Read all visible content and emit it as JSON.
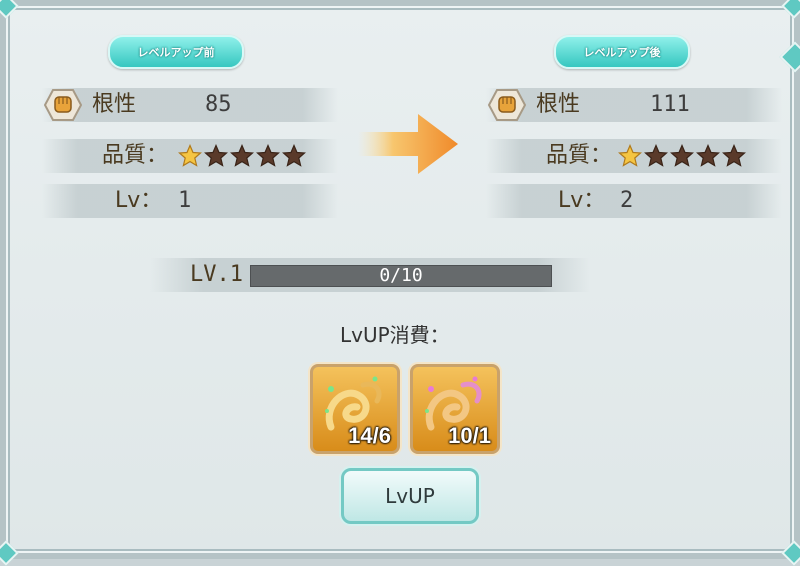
{
  "before": {
    "header": "レベルアップ前",
    "stat_label": "根性",
    "stat_value": "85",
    "quality_label": "品質：",
    "quality_stars_filled": 1,
    "quality_stars_total": 5,
    "lv_label": "Lv：",
    "lv_value": "1"
  },
  "after": {
    "header": "レベルアップ後",
    "stat_label": "根性",
    "stat_value": "111",
    "quality_label": "品質：",
    "quality_stars_filled": 1,
    "quality_stars_total": 5,
    "lv_label": "Lv：",
    "lv_value": "2"
  },
  "progress": {
    "level_label": "LV.1",
    "text": "0/10",
    "fraction": 0
  },
  "cost": {
    "label": "LvUP消費：",
    "items": [
      {
        "count": "14/6",
        "icon": "dragon-item-icon"
      },
      {
        "count": "10/1",
        "icon": "dragon-item-icon"
      }
    ]
  },
  "button": {
    "label": "LvUP"
  },
  "colors": {
    "accent": "#36c7c0",
    "star_filled": "#f5c542",
    "star_empty": "#5a3a2a"
  }
}
